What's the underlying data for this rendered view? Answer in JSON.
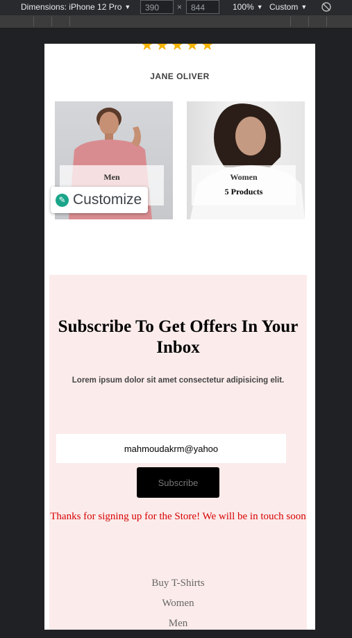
{
  "devtools": {
    "dimensions_label": "Dimensions: iPhone 12 Pro",
    "width": "390",
    "times": "×",
    "height": "844",
    "zoom": "100%",
    "throttle": "Custom"
  },
  "rating": {
    "stars": "★★★★★",
    "reviewer": "JANE OLIVER"
  },
  "categories": [
    {
      "name": "Men",
      "count": ""
    },
    {
      "name": "Women",
      "count": "5 Products"
    }
  ],
  "customize": {
    "label": "Customize"
  },
  "subscribe": {
    "title": "Subscribe To Get Offers In Your Inbox",
    "text": "Lorem ipsum dolor sit amet consectetur adipisicing elit.",
    "email_value": "mahmoudakrm@yahoo",
    "button_label": "Subscribe",
    "thanks": "Thanks for signing up for the Store! We will be in touch soon"
  },
  "footer": {
    "links": [
      "Buy T-Shirts",
      "Women",
      "Men"
    ]
  },
  "colors": {
    "accent_error": "#d80000",
    "section_bg": "#fbeceb",
    "star": "#f5b301"
  }
}
